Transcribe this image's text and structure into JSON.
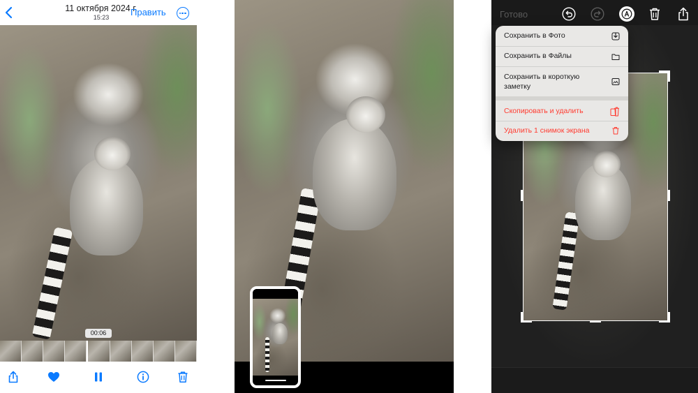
{
  "panel1": {
    "date": "11 октября 2024 г.",
    "time": "15:23",
    "edit_label": "Править",
    "duration": "00:06",
    "icons": [
      "chevron-left-icon",
      "ellipsis-circle-icon",
      "share-icon",
      "heart-icon",
      "pause-icon",
      "info-icon",
      "trash-icon"
    ],
    "accent_color": "#0a7aff"
  },
  "panel3": {
    "done_label": "Готово",
    "toolbar_icons": [
      "undo-icon",
      "redo-icon",
      "markup-pen-icon",
      "trash-icon",
      "share-icon"
    ],
    "menu": [
      {
        "label": "Сохранить в Фото",
        "icon": "save-to-photos-icon",
        "destructive": false
      },
      {
        "label": "Сохранить в Файлы",
        "icon": "folder-icon",
        "destructive": false
      },
      {
        "label": "Сохранить в короткую заметку",
        "icon": "quick-note-icon",
        "destructive": false
      },
      {
        "label": "Скопировать и удалить",
        "icon": "copy-delete-icon",
        "destructive": true
      },
      {
        "label": "Удалить 1 снимок экрана",
        "icon": "trash-icon",
        "destructive": true
      }
    ],
    "destructive_color": "#ff3b30"
  }
}
